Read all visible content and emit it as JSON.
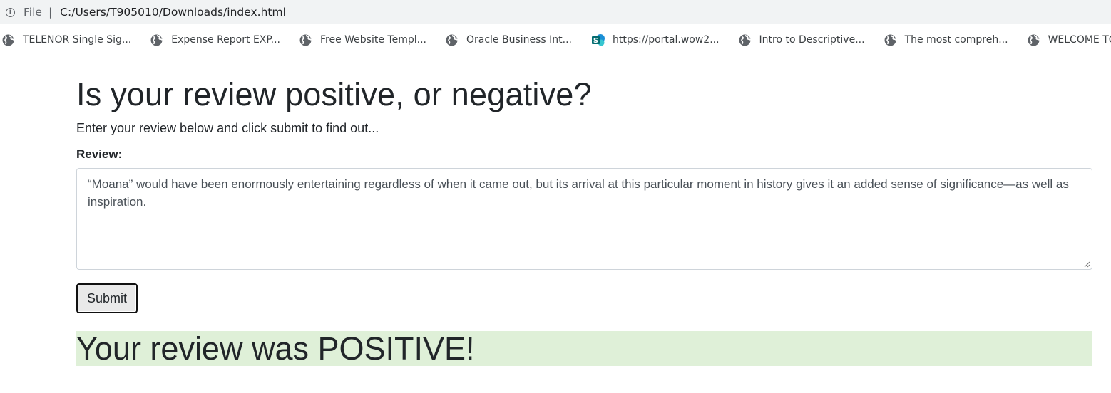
{
  "browser": {
    "scheme": "File",
    "url": "C:/Users/T905010/Downloads/index.html",
    "bookmarks": [
      {
        "label": "TELENOR Single Sig...",
        "icon": "globe-icon"
      },
      {
        "label": "Expense Report EXP...",
        "icon": "globe-icon"
      },
      {
        "label": "Free Website Templ...",
        "icon": "globe-icon"
      },
      {
        "label": "Oracle Business Int...",
        "icon": "globe-icon"
      },
      {
        "label": "https://portal.wow2...",
        "icon": "sharepoint-icon"
      },
      {
        "label": "Intro to Descriptive...",
        "icon": "globe-icon"
      },
      {
        "label": "The most compreh...",
        "icon": "globe-icon"
      },
      {
        "label": "WELCOME TO OCT...",
        "icon": "globe-icon"
      }
    ]
  },
  "page": {
    "title": "Is your review positive, or negative?",
    "lead": "Enter your review below and click submit to find out...",
    "review_label": "Review:",
    "review_value": "“Moana” would have been enormously entertaining regardless of when it came out, but its arrival at this particular moment in history gives it an added sense of significance—as well as inspiration.",
    "submit_label": "Submit",
    "result_text": "Your review was POSITIVE!"
  },
  "colors": {
    "result_background": "#dff0d8",
    "chrome_background": "#f1f3f4"
  }
}
